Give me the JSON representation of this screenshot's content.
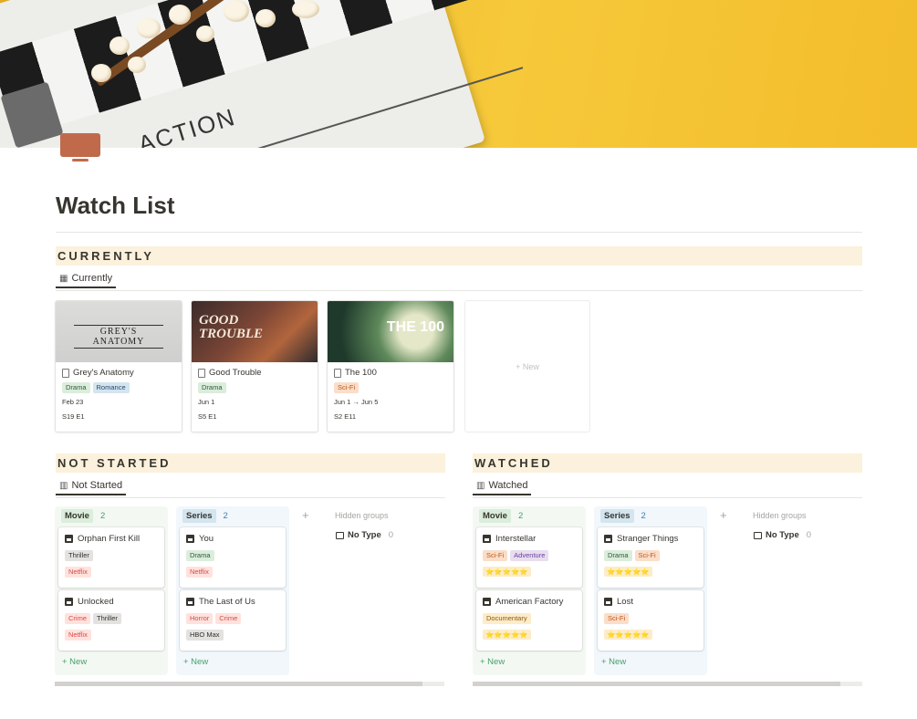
{
  "page": {
    "title": "Watch List"
  },
  "cover": {
    "slate_text": "ACTION"
  },
  "currently": {
    "heading": "CURRENTLY",
    "view_label": "Currently",
    "new_label": "+ New",
    "cards": [
      {
        "title": "Grey's Anatomy",
        "image_text": "GREY'S ANATOMY",
        "tags": [
          {
            "label": "Drama",
            "color": "green"
          },
          {
            "label": "Romance",
            "color": "blue"
          }
        ],
        "date": "Feb 23",
        "episode": "S19 E1"
      },
      {
        "title": "Good Trouble",
        "image_text": "GOOD TROUBLE",
        "tags": [
          {
            "label": "Drama",
            "color": "green"
          }
        ],
        "date": "Jun 1",
        "episode": "S5 E1"
      },
      {
        "title": "The 100",
        "image_text": "THE 100",
        "tags": [
          {
            "label": "Sci-Fi",
            "color": "orange"
          }
        ],
        "date": "Jun 1 → Jun 5",
        "episode": "S2 E11"
      }
    ]
  },
  "not_started": {
    "heading": "NOT STARTED",
    "view_label": "Not Started",
    "hidden_groups": "Hidden groups",
    "no_type": {
      "label": "No Type",
      "count": "0"
    },
    "new_label": "+ New",
    "groups": [
      {
        "name": "Movie",
        "count": "2",
        "color": "green",
        "cards": [
          {
            "title": "Orphan First Kill",
            "rows": [
              [
                {
                  "label": "Thriller",
                  "color": "gray"
                }
              ],
              [
                {
                  "label": "Netflix",
                  "color": "red"
                }
              ]
            ]
          },
          {
            "title": "Unlocked",
            "rows": [
              [
                {
                  "label": "Crime",
                  "color": "red"
                },
                {
                  "label": "Thriller",
                  "color": "gray"
                }
              ],
              [
                {
                  "label": "Netflix",
                  "color": "red"
                }
              ]
            ]
          }
        ]
      },
      {
        "name": "Series",
        "count": "2",
        "color": "blue",
        "cards": [
          {
            "title": "You",
            "rows": [
              [
                {
                  "label": "Drama",
                  "color": "green"
                }
              ],
              [
                {
                  "label": "Netflix",
                  "color": "red"
                }
              ]
            ]
          },
          {
            "title": "The Last of Us",
            "rows": [
              [
                {
                  "label": "Horror",
                  "color": "red"
                },
                {
                  "label": "Crime",
                  "color": "red"
                }
              ],
              [
                {
                  "label": "HBO Max",
                  "color": "gray"
                }
              ]
            ]
          }
        ]
      }
    ]
  },
  "watched": {
    "heading": "WATCHED",
    "view_label": "Watched",
    "hidden_groups": "Hidden groups",
    "no_type": {
      "label": "No Type",
      "count": "0"
    },
    "new_label": "+ New",
    "groups": [
      {
        "name": "Movie",
        "count": "2",
        "color": "green",
        "cards": [
          {
            "title": "Interstellar",
            "rows": [
              [
                {
                  "label": "Sci-Fi",
                  "color": "orange"
                },
                {
                  "label": "Adventure",
                  "color": "purple"
                }
              ]
            ],
            "stars": "⭐⭐⭐⭐⭐"
          },
          {
            "title": "American Factory",
            "rows": [
              [
                {
                  "label": "Documentary",
                  "color": "yellow"
                }
              ]
            ],
            "stars": "⭐⭐⭐⭐⭐"
          }
        ]
      },
      {
        "name": "Series",
        "count": "2",
        "color": "blue",
        "cards": [
          {
            "title": "Stranger Things",
            "rows": [
              [
                {
                  "label": "Drama",
                  "color": "green"
                },
                {
                  "label": "Sci-Fi",
                  "color": "orange"
                }
              ]
            ],
            "stars": "⭐⭐⭐⭐⭐"
          },
          {
            "title": "Lost",
            "rows": [
              [
                {
                  "label": "Sci-Fi",
                  "color": "orange"
                }
              ]
            ],
            "stars": "⭐⭐⭐⭐⭐"
          }
        ]
      }
    ]
  },
  "colors": {
    "accent_green": "#46a06d",
    "section_bg": "#fbf1dc",
    "icon_tv": "#c06a4b"
  }
}
